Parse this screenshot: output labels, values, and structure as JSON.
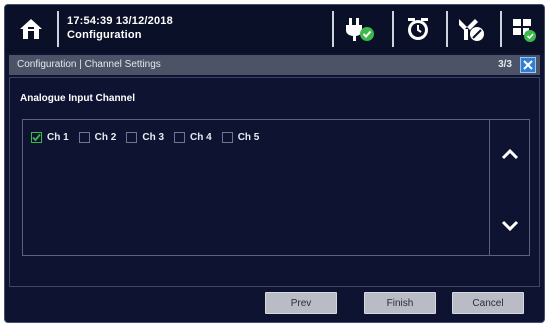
{
  "header": {
    "time_date": "17:54:39 13/12/2018",
    "mode": "Configuration",
    "icons": [
      "home-icon",
      "power-plug-ok-icon",
      "alarm-clock-icon",
      "tools-disabled-icon",
      "network-config-icon"
    ]
  },
  "titlebar": {
    "title": "Configuration | Channel Settings",
    "page": "3/3"
  },
  "section": {
    "title": "Analogue Input Channel"
  },
  "channels": [
    {
      "label": "Ch 1",
      "checked": true
    },
    {
      "label": "Ch 2",
      "checked": false
    },
    {
      "label": "Ch 3",
      "checked": false
    },
    {
      "label": "Ch 4",
      "checked": false
    },
    {
      "label": "Ch 5",
      "checked": false
    }
  ],
  "footer": {
    "prev_label": "Prev",
    "finish_label": "Finish",
    "cancel_label": "Cancel"
  },
  "colors": {
    "background": "#0d1330",
    "titlebar": "#4c5366",
    "accent_green": "#3db84a",
    "close_blue": "#2f7fd6",
    "button": "#b9bcc5"
  }
}
